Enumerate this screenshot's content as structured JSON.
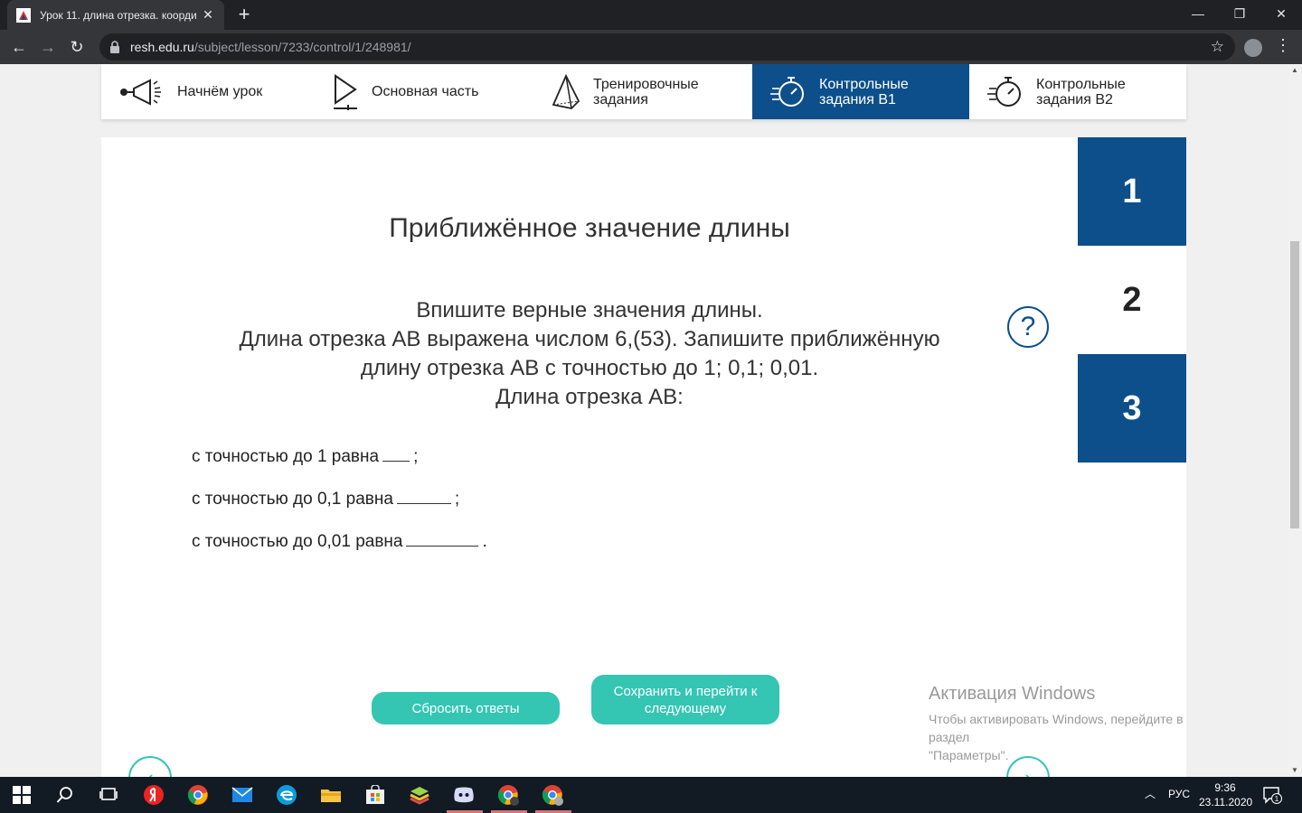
{
  "browser": {
    "tab_title": "Урок 11. длина отрезка. коорди",
    "url_host": "resh.edu.ru",
    "url_path": "/subject/lesson/7233/control/1/248981/"
  },
  "lesson_nav": [
    {
      "label": "Начнём урок"
    },
    {
      "label": "Основная часть"
    },
    {
      "label_line1": "Тренировочные",
      "label_line2": "задания"
    },
    {
      "label_line1": "Контрольные",
      "label_line2": "задания В1"
    },
    {
      "label_line1": "Контрольные",
      "label_line2": "задания В2"
    }
  ],
  "task": {
    "title": "Приближённое значение длины",
    "instruction": [
      "Впишите верные значения длины.",
      "Длина отрезка АВ выражена числом 6,(53). Запишите приближённую",
      "длину отрезка АВ с точностью до 1; 0,1; 0,01.",
      "Длина отрезка АВ:"
    ],
    "help_symbol": "?",
    "rows": [
      {
        "label": "с точностью до 1 равна",
        "suffix": ";"
      },
      {
        "label": "с точностью до 0,1 равна",
        "suffix": ";"
      },
      {
        "label": "с точностью до 0,01 равна",
        "suffix": "."
      }
    ]
  },
  "buttons": {
    "reset": "Сбросить ответы",
    "save_line1": "Сохранить и перейти к",
    "save_line2": "следующему"
  },
  "task_numbers": [
    "1",
    "2",
    "3"
  ],
  "windows_activation": {
    "title": "Активация Windows",
    "line1": "Чтобы активировать Windows, перейдите в раздел",
    "line2": "\"Параметры\"."
  },
  "taskbar": {
    "lang": "РУС",
    "time": "9:36",
    "date": "23.11.2020",
    "notif_count": "1"
  },
  "colors": {
    "accent_blue": "#0d4f8b",
    "teal": "#34c5b3"
  }
}
